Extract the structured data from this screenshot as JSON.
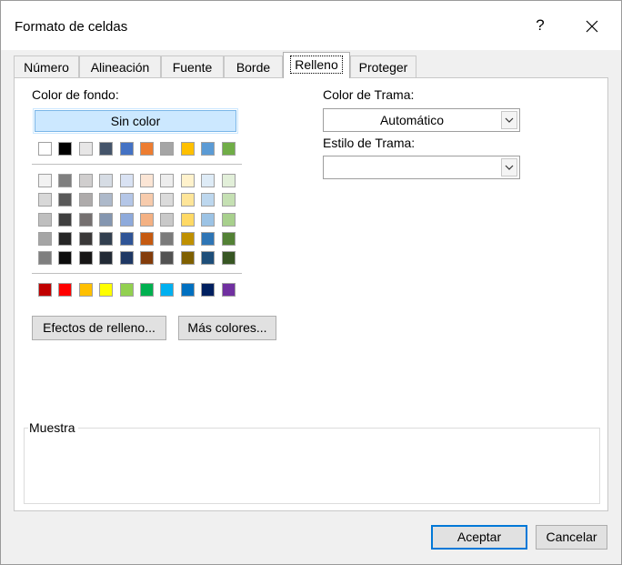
{
  "dialog": {
    "title": "Formato de celdas",
    "help_label": "?"
  },
  "tabs": [
    {
      "label": "Número"
    },
    {
      "label": "Alineación"
    },
    {
      "label": "Fuente"
    },
    {
      "label": "Borde"
    },
    {
      "label": "Relleno",
      "active": true
    },
    {
      "label": "Proteger"
    }
  ],
  "fill": {
    "background_label": "Color de fondo:",
    "no_color_label": "Sin color",
    "effects_button": "Efectos de relleno...",
    "more_colors_button": "Más colores...",
    "theme_colors": [
      "#ffffff",
      "#000000",
      "#e7e6e6",
      "#44546a",
      "#4472c4",
      "#ed7d31",
      "#a5a5a5",
      "#ffc000",
      "#5b9bd5",
      "#70ad47"
    ],
    "tint_rows": [
      [
        "#f2f2f2",
        "#7f7f7f",
        "#d0cece",
        "#d6dce4",
        "#d9e2f3",
        "#fbe5d5",
        "#ededed",
        "#fff2cc",
        "#deebf6",
        "#e2efd9"
      ],
      [
        "#d8d8d8",
        "#595959",
        "#aeabab",
        "#adb9ca",
        "#b4c6e7",
        "#f7cbac",
        "#dbdbdb",
        "#fee599",
        "#bdd7ee",
        "#c5e0b3"
      ],
      [
        "#bfbfbf",
        "#3f3f3f",
        "#757070",
        "#8496b0",
        "#8eaadb",
        "#f4b183",
        "#c9c9c9",
        "#ffd965",
        "#9cc3e5",
        "#a8d08d"
      ],
      [
        "#a5a5a5",
        "#262626",
        "#3a3838",
        "#323f4f",
        "#2f5496",
        "#c55a11",
        "#7b7b7b",
        "#bf9000",
        "#2e75b5",
        "#538135"
      ],
      [
        "#7f7f7f",
        "#0c0c0c",
        "#171616",
        "#222a35",
        "#1f3864",
        "#833c0b",
        "#525252",
        "#7f6000",
        "#1e4e79",
        "#375623"
      ]
    ],
    "standard_colors": [
      "#c00000",
      "#ff0000",
      "#ffc000",
      "#ffff00",
      "#92d050",
      "#00b050",
      "#00b0f0",
      "#0070c0",
      "#002060",
      "#7030a0"
    ]
  },
  "pattern": {
    "color_label": "Color de Trama:",
    "color_value": "Automático",
    "style_label": "Estilo de Trama:",
    "style_value": ""
  },
  "sample": {
    "label": "Muestra"
  },
  "footer": {
    "ok_label": "Aceptar",
    "cancel_label": "Cancelar"
  },
  "colors": {
    "accent": "#0078d7",
    "selected_fill": "#cce8ff"
  }
}
